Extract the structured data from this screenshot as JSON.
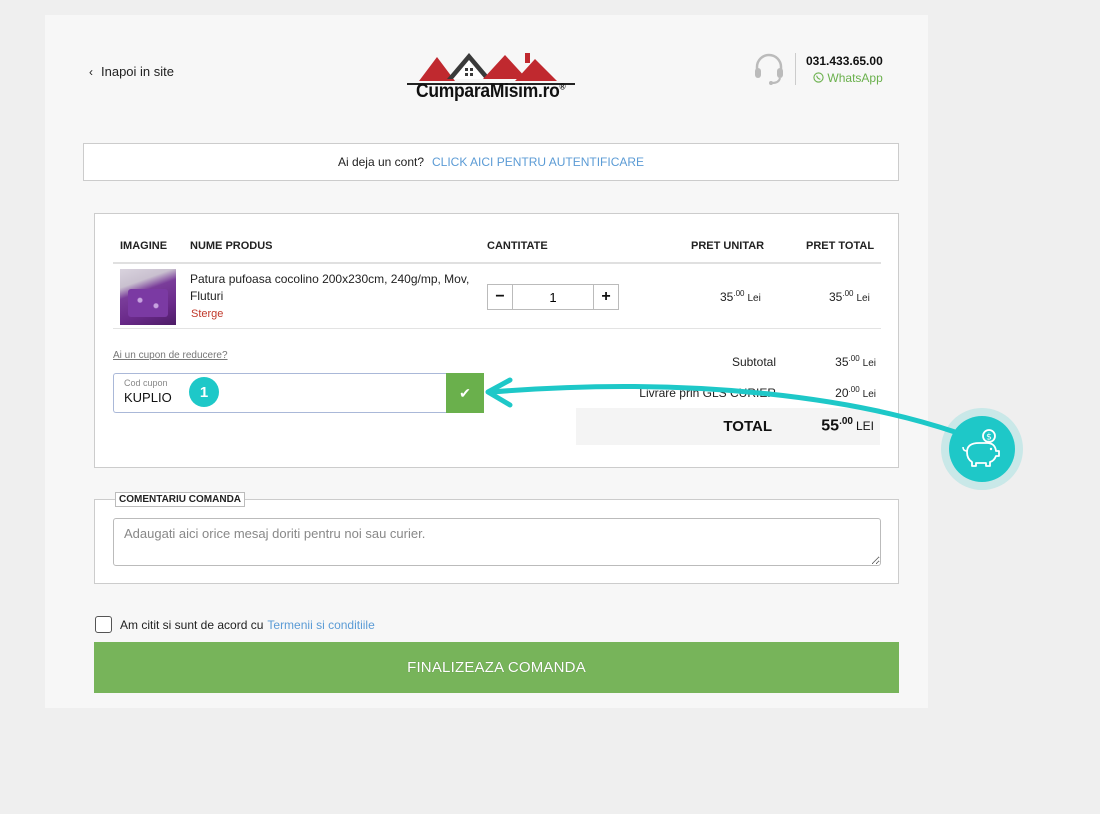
{
  "header": {
    "back_label": "Inapoi in site",
    "logo_text": "CumparaMisim.ro",
    "logo_mark": "®",
    "phone": "031.433.65.00",
    "whatsapp": "WhatsApp"
  },
  "login": {
    "prompt": "Ai deja un cont?",
    "link": "CLICK AICI PENTRU AUTENTIFICARE"
  },
  "cart": {
    "columns": [
      "IMAGINE",
      "NUME PRODUS",
      "CANTITATE",
      "PRET UNITAR",
      "PRET TOTAL"
    ],
    "item": {
      "name": "Patura pufoasa cocolino 200x230cm, 240g/mp, Mov, Fluturi",
      "remove": "Sterge",
      "quantity": "1",
      "unit_price_int": "35",
      "unit_price_dec": ".00",
      "total_price_int": "35",
      "total_price_dec": ".00",
      "currency": "Lei"
    },
    "coupon": {
      "question": "Ai un cupon de reducere?",
      "label": "Cod cupon",
      "value": "KUPLIO",
      "step_badge": "1"
    },
    "summary": {
      "subtotal_label": "Subtotal",
      "subtotal_int": "35",
      "subtotal_dec": ".00",
      "shipping_label": "Livrare prin GLS CURIER",
      "shipping_int": "20",
      "shipping_dec": ".00",
      "currency": "Lei",
      "total_label": "TOTAL",
      "total_int": "55",
      "total_dec": ".00",
      "total_currency": "LEI"
    }
  },
  "comment": {
    "legend": "COMENTARIU COMANDA",
    "placeholder": "Adaugati aici orice mesaj doriti pentru noi sau curier."
  },
  "terms": {
    "text": "Am citit si sunt de acord cu",
    "link": "Termenii si conditiile"
  },
  "finalize_label": "FINALIZEAZA COMANDA",
  "colors": {
    "accent_green": "#77b45a",
    "link_blue": "#5b9bd5",
    "remove_red": "#c0392b",
    "overlay_teal": "#1ec8c8"
  }
}
